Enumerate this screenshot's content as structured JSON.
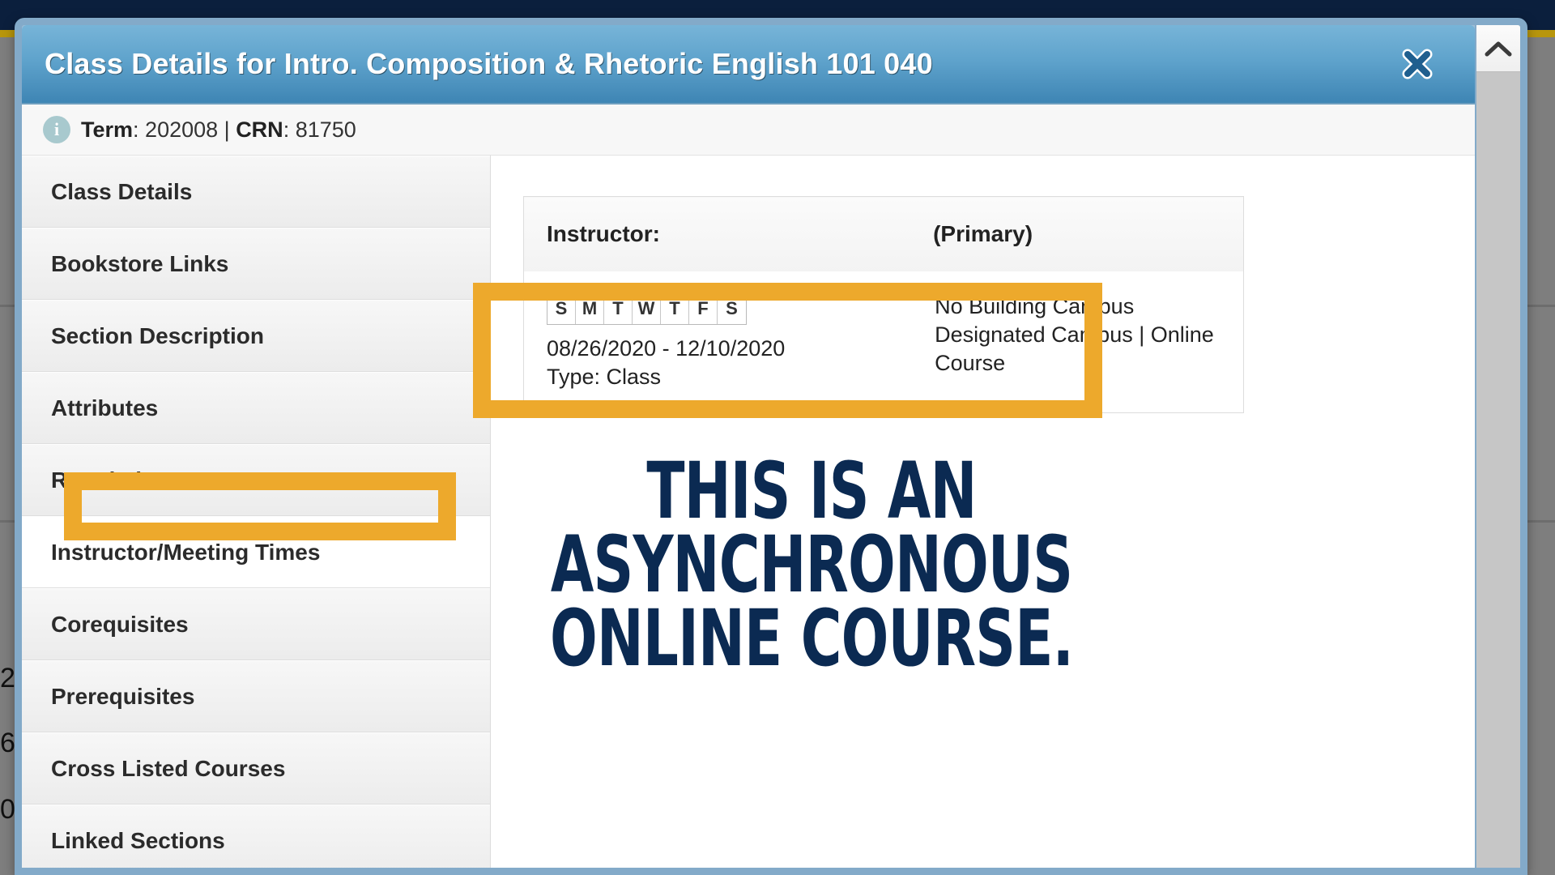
{
  "background": {
    "row_numbers": [
      "2",
      "6",
      "0"
    ],
    "topbar_color": "#0b1f3d",
    "gold_strip_color": "#b8960c",
    "body_color": "#7e7e7e"
  },
  "modal": {
    "title": "Class Details for Intro. Composition & Rhetoric English 101 040",
    "close_label": "✕",
    "term_label": "Term",
    "term_value": "202008",
    "separator": "|",
    "crn_label": "CRN",
    "crn_value": "81750",
    "info_glyph": "i",
    "scroll_up_glyph": "^",
    "titlebar_gradient_top": "#77b4d8",
    "titlebar_gradient_bottom": "#3e85b4",
    "border_color": "#83aac9"
  },
  "sidebar": {
    "items": [
      {
        "label": "Class Details",
        "active": false
      },
      {
        "label": "Bookstore Links",
        "active": false
      },
      {
        "label": "Section Description",
        "active": false
      },
      {
        "label": "Attributes",
        "active": false
      },
      {
        "label": "Restrictions",
        "active": false
      },
      {
        "label": "Instructor/Meeting Times",
        "active": true
      },
      {
        "label": "Corequisites",
        "active": false
      },
      {
        "label": "Prerequisites",
        "active": false
      },
      {
        "label": "Cross Listed Courses",
        "active": false
      },
      {
        "label": "Linked Sections",
        "active": false
      }
    ]
  },
  "meeting": {
    "instructor_label": "Instructor:",
    "instructor_name": "",
    "primary_label": "(Primary)",
    "days": [
      "S",
      "M",
      "T",
      "W",
      "T",
      "F",
      "S"
    ],
    "date_range": "08/26/2020 - 12/10/2020",
    "type_line": "Type: Class",
    "location_lines": [
      "No Building Campus",
      "Designated Campus | Online",
      "Course"
    ]
  },
  "annotations": {
    "highlight_color": "#eda92c",
    "caption_color": "#0b2a52",
    "caption_lines": [
      "THIS IS AN",
      "ASYNCHRONOUS",
      "ONLINE COURSE."
    ]
  }
}
